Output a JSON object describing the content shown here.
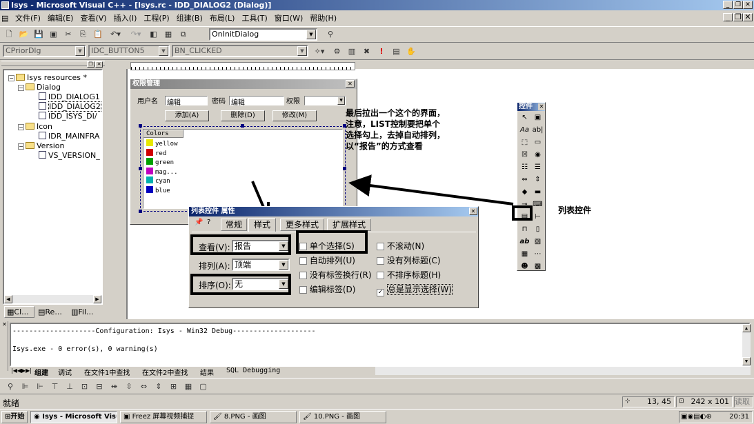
{
  "window": {
    "title": "Isys - Microsoft Visual C++ - [Isys.rc - IDD_DIALOG2 (Dialog)]"
  },
  "menu": [
    "文件(F)",
    "编辑(E)",
    "查看(V)",
    "插入(I)",
    "工程(P)",
    "组建(B)",
    "布局(L)",
    "工具(T)",
    "窗口(W)",
    "帮助(H)"
  ],
  "toolbar": {
    "func_combo": "OnInitDialog",
    "class_combo": "CPriorDlg",
    "id_combo": "IDC_BUTTON5",
    "msg_combo": "BN_CLICKED"
  },
  "workspace": {
    "tree": [
      "Isys resources *",
      "Dialog",
      "IDD_DIALOG1",
      "IDD_DIALOG2",
      "IDD_ISYS_DI/",
      "Icon",
      "IDR_MAINFRA",
      "Version",
      "VS_VERSION_"
    ],
    "tabs": [
      "Cl...",
      "Re...",
      "Fil..."
    ]
  },
  "dialog": {
    "title": "权限管理",
    "label_user": "用户名",
    "user_value": "编辑",
    "label_pwd": "密码",
    "pwd_value": "编辑",
    "label_perm": "权限",
    "btn_add": "添加(A)",
    "btn_delete": "删除(D)",
    "btn_modify": "修改(M)",
    "list_header": "Colors",
    "list_items": [
      {
        "label": "yellow",
        "color": "#e8e800"
      },
      {
        "label": "red",
        "color": "#d00000"
      },
      {
        "label": "green",
        "color": "#00a000"
      },
      {
        "label": "mag...",
        "color": "#c000c0"
      },
      {
        "label": "cyan",
        "color": "#00b0b0"
      },
      {
        "label": "blue",
        "color": "#0000c0"
      }
    ]
  },
  "props": {
    "title": "列表控件 属性",
    "tabs": [
      "常规",
      "样式",
      "更多样式",
      "扩展样式"
    ],
    "view_label": "查看(V):",
    "view_value": "报告",
    "arrange_label": "排列(A):",
    "arrange_value": "顶端",
    "sort_label": "排序(O):",
    "sort_value": "无",
    "cb_single_select": "单个选择(S)",
    "cb_auto_arrange": "自动排列(U)",
    "cb_no_label_wrap": "没有标签换行(R)",
    "cb_edit_labels": "编辑标签(D)",
    "cb_no_scroll": "不滚动(N)",
    "cb_no_column_header": "没有列标题(C)",
    "cb_no_sort_header": "不排序标题(H)",
    "cb_show_sel_always": "总是显示选择(W)"
  },
  "annotation": {
    "note": "最后拉出一个这个的界面，注意，LIST控制要把单个选择勾上，去掉自动排列，以“报告”的方式查看",
    "list_control": "列表控件"
  },
  "palette": {
    "title": "控件"
  },
  "output": {
    "line1": "--------------------Configuration: Isys - Win32 Debug--------------------",
    "line2": "Isys.exe - 0 error(s), 0 warning(s)",
    "tabs": [
      "组建",
      "调试",
      "在文件1中查找",
      "在文件2中查找",
      "结果",
      "SQL Debugging"
    ]
  },
  "status": {
    "text": "就绪",
    "pos": "13, 45",
    "size": "242 x 101",
    "mode": "读取"
  },
  "taskbar": {
    "start": "开始",
    "tasks": [
      "Isys - Microsoft Visual C...",
      "Freez 屏幕视频捕捉",
      "8.PNG - 画图",
      "10.PNG - 画图"
    ],
    "time": "20:31"
  }
}
